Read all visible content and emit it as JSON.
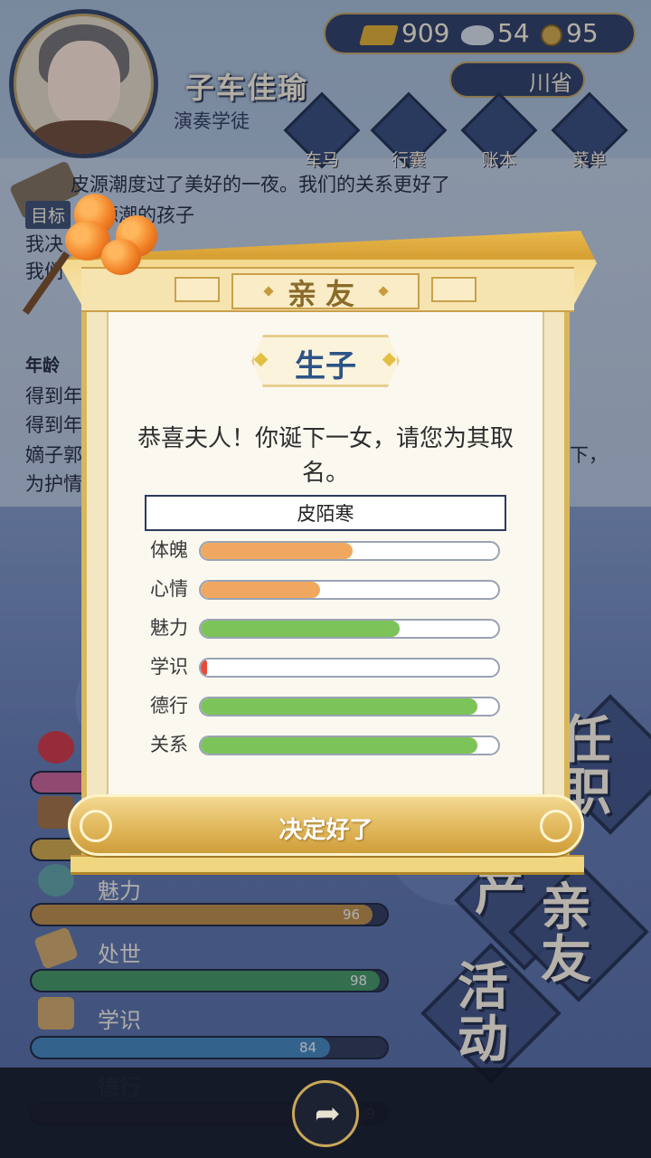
{
  "player": {
    "name": "子车佳瑜",
    "title": "演奏学徒"
  },
  "currency": {
    "gold": "909",
    "silver": "54",
    "coins": "95"
  },
  "region": "川省",
  "top_menu": [
    {
      "label": "车马"
    },
    {
      "label": "行囊"
    },
    {
      "label": "账本"
    },
    {
      "label": "菜单"
    }
  ],
  "log": {
    "goal_label": "目标",
    "lines": [
      "皮源潮度过了美好的一夜。我们的关系更好了",
      "源潮的孩子",
      "我决",
      "我们"
    ],
    "age_label": "年龄",
    "detail_lines": [
      "得到年",
      "得到年",
      "嫡子郭",
      "为护情"
    ],
    "trailing_fragments": [
      "下，"
    ]
  },
  "background_stats": [
    {
      "name": "魅力",
      "value": "96",
      "color": "#b5853f"
    },
    {
      "name": "处世",
      "value": "98",
      "color": "#3f8f5a"
    },
    {
      "name": "学识",
      "value": "84",
      "color": "#3f7fb0"
    },
    {
      "name": "德行",
      "value": "9",
      "color": "#7a3f9a"
    }
  ],
  "big_buttons": {
    "family": "亲友",
    "activity": "活动",
    "office_partial": "任职",
    "property_partial": "产"
  },
  "modal": {
    "header": "亲友",
    "subtitle": "生子",
    "message": "恭喜夫人！你诞下一女，请您为其取名。",
    "name_value": "皮陌寒",
    "attributes": [
      {
        "label": "体魄",
        "level": 0.51,
        "color": "#f0a860"
      },
      {
        "label": "心情",
        "level": 0.4,
        "color": "#f0a860"
      },
      {
        "label": "魅力",
        "level": 0.67,
        "color": "#7cc35a"
      },
      {
        "label": "学识",
        "level": 0.02,
        "color": "#e8483a"
      },
      {
        "label": "德行",
        "level": 0.93,
        "color": "#7cc35a"
      },
      {
        "label": "关系",
        "level": 0.93,
        "color": "#7cc35a"
      }
    ],
    "confirm_label": "决定好了"
  },
  "icons": {
    "share": "share-icon"
  }
}
